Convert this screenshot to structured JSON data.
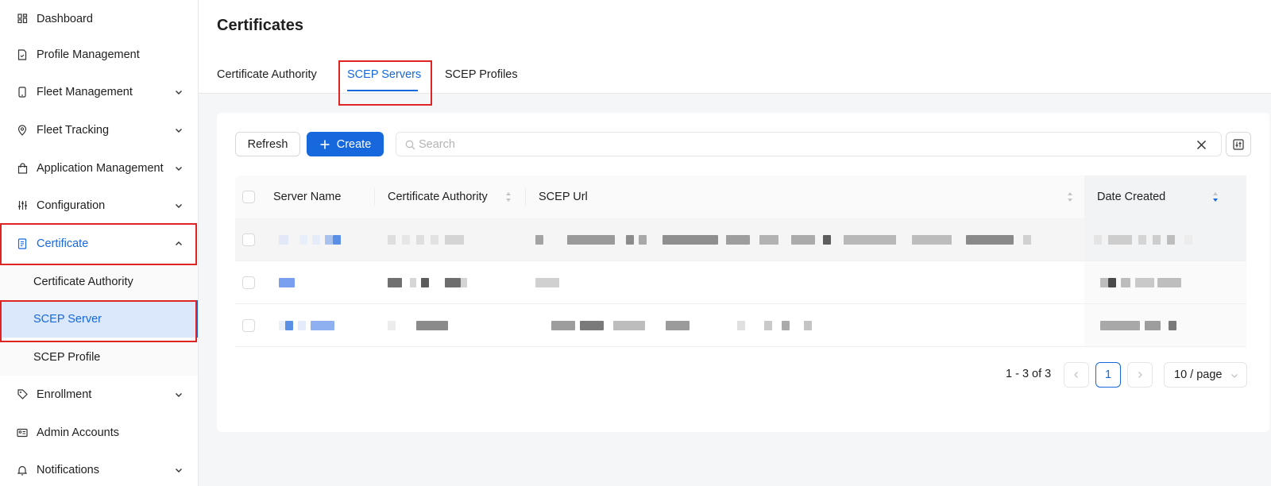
{
  "sidebar": {
    "items": [
      {
        "label": "Dashboard",
        "icon": "dashboard-icon",
        "has_chevron": false
      },
      {
        "label": "Profile Management",
        "icon": "file-icon",
        "has_chevron": false
      },
      {
        "label": "Fleet Management",
        "icon": "mobile-icon",
        "has_chevron": true
      },
      {
        "label": "Fleet Tracking",
        "icon": "location-pin-icon",
        "has_chevron": true
      },
      {
        "label": "Application Management",
        "icon": "shopping-bag-icon",
        "has_chevron": true
      },
      {
        "label": "Configuration",
        "icon": "sliders-icon",
        "has_chevron": true
      },
      {
        "label": "Certificate",
        "icon": "certificate-icon",
        "has_chevron": true,
        "expanded": true
      },
      {
        "label": "Enrollment",
        "icon": "tag-icon",
        "has_chevron": true
      },
      {
        "label": "Admin Accounts",
        "icon": "id-card-icon",
        "has_chevron": false
      },
      {
        "label": "Notifications",
        "icon": "bell-icon",
        "has_chevron": true
      }
    ],
    "certificate_submenu": [
      {
        "label": "Certificate Authority"
      },
      {
        "label": "SCEP Server",
        "selected": true
      },
      {
        "label": "SCEP Profile"
      }
    ]
  },
  "page": {
    "title": "Certificates",
    "tabs": [
      {
        "label": "Certificate Authority"
      },
      {
        "label": "SCEP Servers",
        "active": true
      },
      {
        "label": "SCEP Profiles"
      }
    ]
  },
  "toolbar": {
    "refresh_label": "Refresh",
    "create_label": "Create",
    "search_placeholder": "Search"
  },
  "table": {
    "columns": [
      "Server Name",
      "Certificate Authority",
      "SCEP Url",
      "Date Created"
    ],
    "rows": [
      {
        "server_name": "",
        "certificate_authority": "",
        "scep_url": "",
        "date_created": ""
      },
      {
        "server_name": "",
        "certificate_authority": "",
        "scep_url": "",
        "date_created": ""
      },
      {
        "server_name": "",
        "certificate_authority": "",
        "scep_url": "",
        "date_created": ""
      }
    ]
  },
  "pagination": {
    "total_label": "1 - 3 of 3",
    "current_page": "1",
    "page_size_label": "10 / page"
  },
  "colors": {
    "accent": "#1668dc",
    "highlight_box": "#e02424",
    "selected_bg": "#dbe8fb"
  }
}
